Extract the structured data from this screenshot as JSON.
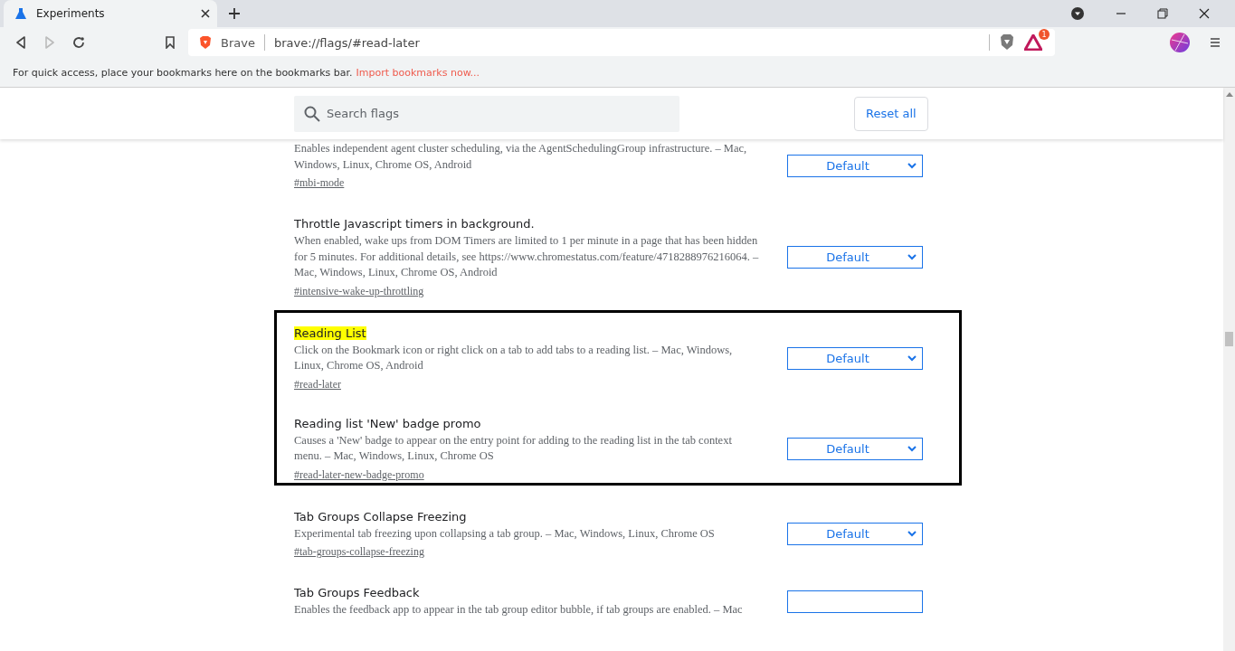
{
  "tab": {
    "title": "Experiments",
    "selected": true
  },
  "address": {
    "site_label": "Brave",
    "url": "brave://flags/#read-later"
  },
  "rewards_badge": "1",
  "bookmarks_bar": {
    "hint": "For quick access, place your bookmarks here on the bookmarks bar.",
    "link": "Import bookmarks now..."
  },
  "search": {
    "placeholder": "Search flags"
  },
  "reset_button": "Reset all",
  "sections": [
    {
      "framed": false,
      "flags": [
        {
          "description": "Enables independent agent cluster scheduling, via the AgentSchedulingGroup infrastructure. – Mac, Windows, Linux, Chrome OS, Android",
          "link": "#mbi-mode",
          "select": "Default"
        },
        {
          "title": "Throttle Javascript timers in background.",
          "description": "When enabled, wake ups from DOM Timers are limited to 1 per minute in a page that has been hidden for 5 minutes. For additional details, see https://www.chromestatus.com/feature/4718288976216064. – Mac, Windows, Linux, Chrome OS, Android",
          "link": "#intensive-wake-up-throttling",
          "select": "Default"
        }
      ]
    },
    {
      "framed": true,
      "flags": [
        {
          "title": "Reading List",
          "description": "Click on the Bookmark icon or right click on a tab to add tabs to a reading list. – Mac, Windows, Linux, Chrome OS, Android",
          "link": "#read-later",
          "select": "Default",
          "highlighted": true
        },
        {
          "title": "Reading list 'New' badge promo",
          "description": "Causes a 'New' badge to appear on the entry point for adding to the reading list in the tab context menu. – Mac, Windows, Linux, Chrome OS",
          "link": "#read-later-new-badge-promo",
          "select": "Default"
        }
      ]
    },
    {
      "framed": false,
      "flags": [
        {
          "title": "Tab Groups Collapse Freezing",
          "description": "Experimental tab freezing upon collapsing a tab group. – Mac, Windows, Linux, Chrome OS",
          "link": "#tab-groups-collapse-freezing",
          "select": "Default"
        },
        {
          "title": "Tab Groups Feedback",
          "description": "Enables the feedback app to appear in the tab group editor bubble, if tab groups are enabled. – Mac"
        }
      ]
    }
  ]
}
